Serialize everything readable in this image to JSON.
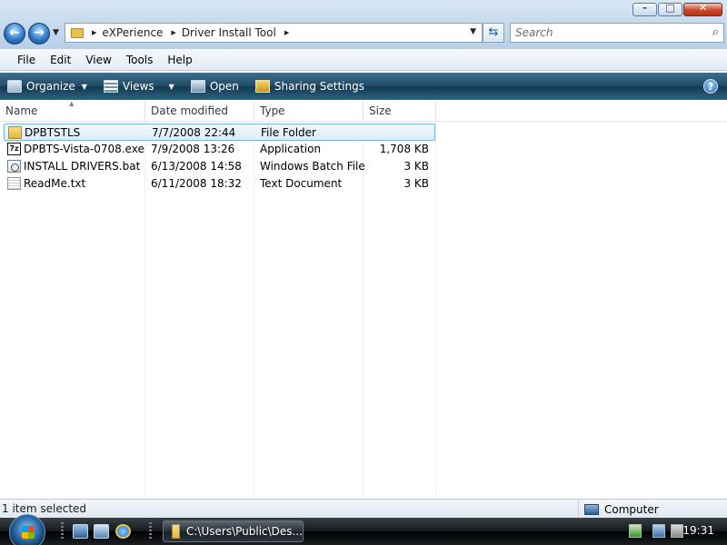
{
  "window": {
    "minimize_glyph": "–",
    "maximize_glyph": "□",
    "close_glyph": "✕"
  },
  "navigation": {
    "back_glyph": "←",
    "forward_glyph": "→",
    "history_glyph": "▼"
  },
  "address": {
    "breadcrumbs": [
      "eXPerience",
      "Driver Install Tool"
    ],
    "arrow_glyph": "▶",
    "dropdown_glyph": "▼",
    "refresh_glyph": "⇆"
  },
  "search": {
    "placeholder": "Search",
    "icon": "magnifier-icon",
    "icon_glyph": "⌕"
  },
  "menu": [
    "File",
    "Edit",
    "View",
    "Tools",
    "Help"
  ],
  "commands": {
    "organize": "Organize",
    "views": "Views",
    "open": "Open",
    "sharing": "Sharing Settings",
    "dropdown_glyph": "▼",
    "help_glyph": "?"
  },
  "columns": {
    "name": "Name",
    "date": "Date modified",
    "type": "Type",
    "size": "Size",
    "sort_glyph": "▲"
  },
  "files": [
    {
      "name": "DPBTSTLS",
      "date": "7/7/2008 22:44",
      "type": "File Folder",
      "size": "",
      "icon": "folder-icon"
    },
    {
      "name": "DPBTS-Vista-0708.exe",
      "date": "7/9/2008 13:26",
      "type": "Application",
      "size": "1,708 KB",
      "icon": "7zip-icon",
      "icon_glyph": "7z"
    },
    {
      "name": "INSTALL DRIVERS.bat",
      "date": "6/13/2008 14:58",
      "type": "Windows Batch File",
      "size": "3 KB",
      "icon": "batch-file-icon"
    },
    {
      "name": "ReadMe.txt",
      "date": "6/11/2008 18:32",
      "type": "Text Document",
      "size": "3 KB",
      "icon": "text-file-icon"
    }
  ],
  "status": {
    "selection": "1 item selected",
    "location": "Computer"
  },
  "taskbar": {
    "task_label": "C:\\Users\\Public\\Des...",
    "clock": "19:31"
  },
  "colors": {
    "command_bar": "#1f4a66",
    "selection_border": "#7fb2e0",
    "taskbar": "#15191d"
  }
}
